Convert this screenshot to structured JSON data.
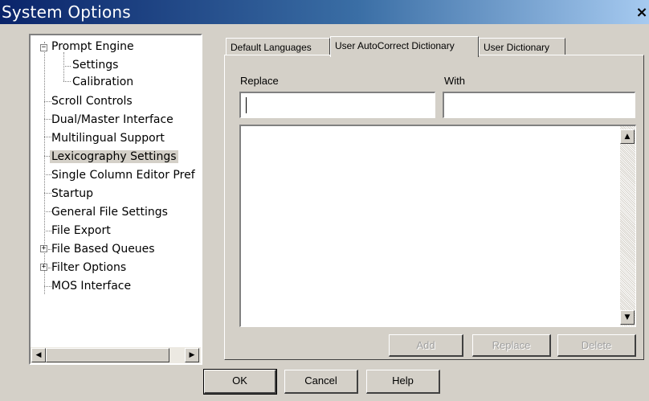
{
  "window": {
    "title": "System Options",
    "close_glyph": "×",
    "close_icon": "close-icon"
  },
  "tree": {
    "items": [
      {
        "label": "Prompt Engine",
        "expander": "−"
      },
      {
        "label": "Settings"
      },
      {
        "label": "Calibration"
      },
      {
        "label": "Scroll Controls"
      },
      {
        "label": "Dual/Master Interface"
      },
      {
        "label": "Multilingual Support"
      },
      {
        "label": "Lexicography Settings",
        "selected": true
      },
      {
        "label": "Single Column Editor Pref"
      },
      {
        "label": "Startup"
      },
      {
        "label": "General File Settings"
      },
      {
        "label": "File Export"
      },
      {
        "label": "File Based Queues",
        "expander": "+"
      },
      {
        "label": "Filter Options",
        "expander": "+"
      },
      {
        "label": "MOS Interface"
      }
    ],
    "scroll_left_glyph": "◀",
    "scroll_right_glyph": "▶"
  },
  "tabs": [
    {
      "label": "Default Languages"
    },
    {
      "label": "User AutoCorrect Dictionary",
      "active": true
    },
    {
      "label": "User Dictionary"
    }
  ],
  "form": {
    "replace_label": "Replace",
    "with_label": "With",
    "replace_value": "",
    "with_value": "",
    "scroll_up_glyph": "▲",
    "scroll_down_glyph": "▼",
    "add_label": "Add",
    "replace_button_label": "Replace",
    "delete_label": "Delete"
  },
  "footer": {
    "ok_label": "OK",
    "cancel_label": "Cancel",
    "help_label": "Help"
  },
  "colors": {
    "face": "#d4d0c8",
    "title_start": "#0a246a",
    "title_end": "#a6caf0"
  }
}
